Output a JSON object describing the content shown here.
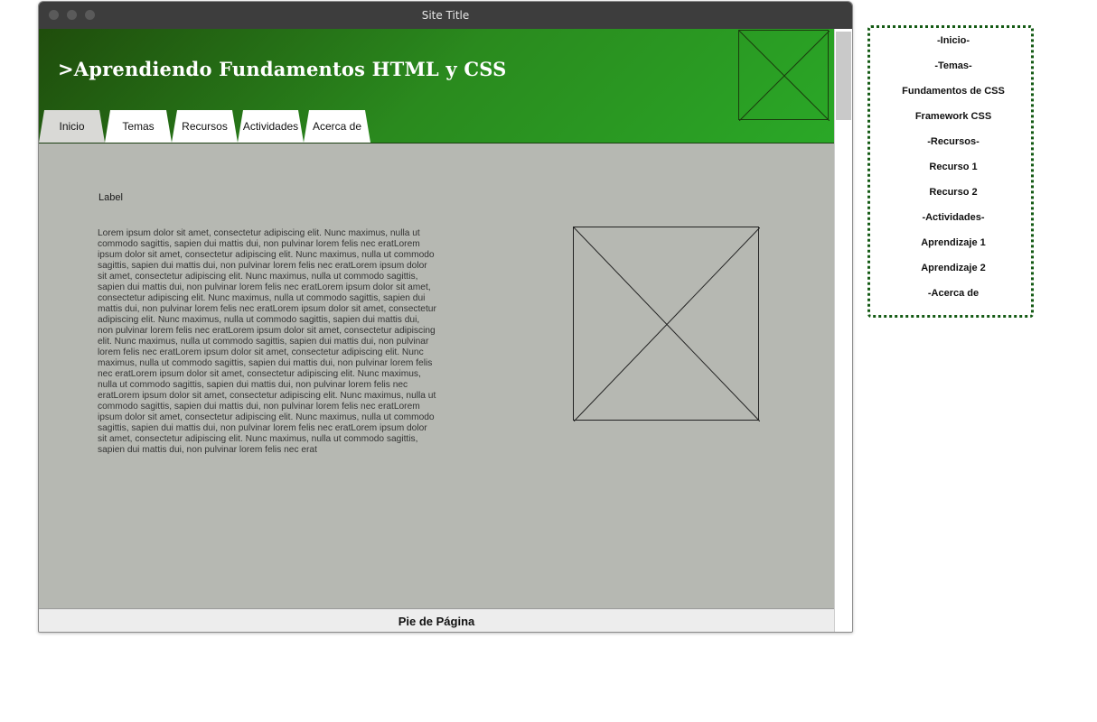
{
  "window": {
    "title": "Site Title"
  },
  "header": {
    "site_title": ">Aprendiendo Fundamentos HTML y CSS",
    "tabs": [
      {
        "label": "Inicio",
        "active": true
      },
      {
        "label": "Temas",
        "active": false
      },
      {
        "label": "Recursos",
        "active": false
      },
      {
        "label": "Actividades",
        "active": false
      },
      {
        "label": "Acerca de",
        "active": false
      }
    ]
  },
  "content": {
    "label": "Label",
    "body": "Lorem ipsum dolor sit amet, consectetur adipiscing elit. Nunc maximus, nulla ut commodo sagittis, sapien dui mattis dui, non pulvinar lorem felis nec eratLorem ipsum dolor sit amet, consectetur adipiscing elit. Nunc maximus, nulla ut commodo sagittis, sapien dui mattis dui, non pulvinar lorem felis nec eratLorem ipsum dolor sit amet, consectetur adipiscing elit. Nunc maximus, nulla ut commodo sagittis, sapien dui mattis dui, non pulvinar lorem felis nec eratLorem ipsum dolor sit amet, consectetur adipiscing elit. Nunc maximus, nulla ut commodo sagittis, sapien dui mattis dui, non pulvinar lorem felis nec eratLorem ipsum dolor sit amet, consectetur adipiscing elit. Nunc maximus, nulla ut commodo sagittis, sapien dui mattis dui, non pulvinar lorem felis nec eratLorem ipsum dolor sit amet, consectetur adipiscing elit. Nunc maximus, nulla ut commodo sagittis, sapien dui mattis dui, non pulvinar lorem felis nec eratLorem ipsum dolor sit amet, consectetur adipiscing elit. Nunc maximus, nulla ut commodo sagittis, sapien dui mattis dui, non pulvinar lorem felis nec eratLorem ipsum dolor sit amet, consectetur adipiscing elit. Nunc maximus, nulla ut commodo sagittis, sapien dui mattis dui, non pulvinar lorem felis nec eratLorem ipsum dolor sit amet, consectetur adipiscing elit. Nunc maximus, nulla ut commodo sagittis, sapien dui mattis dui, non pulvinar lorem felis nec eratLorem ipsum dolor sit amet, consectetur adipiscing elit. Nunc maximus, nulla ut commodo sagittis, sapien dui mattis dui, non pulvinar lorem felis nec eratLorem ipsum dolor sit amet, consectetur adipiscing elit. Nunc maximus, nulla ut commodo sagittis, sapien dui mattis dui, non pulvinar lorem felis nec erat"
  },
  "footer": {
    "text": "Pie de Página"
  },
  "sidenav": {
    "items": [
      "-Inicio-",
      "-Temas-",
      "Fundamentos de CSS",
      "Framework CSS",
      "-Recursos-",
      "Recurso 1",
      "Recurso 2",
      "-Actividades-",
      "Aprendizaje 1",
      "Aprendizaje 2",
      "-Acerca de"
    ]
  },
  "colors": {
    "header_start": "#1f4d0c",
    "header_end": "#2aa827",
    "content_bg": "#b6b8b2",
    "sidenav_border": "#145a14"
  }
}
